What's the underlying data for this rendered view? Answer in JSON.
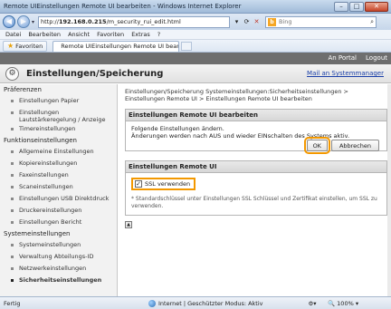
{
  "window": {
    "title": "Remote UIEinstellungen Remote UI bearbeiten",
    "title_suffix": "- Windows Internet Explorer",
    "min": "–",
    "max": "□",
    "close": "✕"
  },
  "navbar": {
    "url_prefix": "http://",
    "url_host": "192.168.0.215",
    "url_path": "/m_security_rui_edit.html",
    "search_placeholder": "Bing",
    "search_logo": "b"
  },
  "menu": [
    "Datei",
    "Bearbeiten",
    "Ansicht",
    "Favoriten",
    "Extras",
    "?"
  ],
  "favbar": {
    "favorites_label": "Favoriten",
    "tab_label": "Remote UIEinstellungen Remote UI bearbeiten"
  },
  "page": {
    "portal": "An Portal",
    "logout": "Logout",
    "header_title": "Einstellungen/Speicherung",
    "main_link": "Mail an Systemmanager",
    "sidebar": {
      "sections": [
        {
          "title": "Präferenzen",
          "items": [
            "Einstellungen Papier",
            "Einstellungen Lautstärkeregelung / Anzeige",
            "Timereinstellungen"
          ]
        },
        {
          "title": "Funktionseinstellungen",
          "items": [
            "Allgemeine Einstellungen",
            "Kopiereinstellungen",
            "Faxeinstellungen",
            "Scaneinstellungen",
            "Einstellungen USB Direktdruck",
            "Druckereinstellungen",
            "Einstellungen Bericht"
          ]
        },
        {
          "title": "Systemeinstellungen",
          "items": [
            "Systemeinstellungen",
            "Verwaltung Abteilungs-ID",
            "Netzwerkeinstellungen",
            "Sicherheitseinstellungen"
          ]
        }
      ]
    },
    "breadcrumb": "Einstellungen/Speicherung Systemeinstellungen:Sicherheitseinstellungen > Einstellungen Remote UI > Einstellungen Remote UI bearbeiten",
    "edit_panel": {
      "title": "Einstellungen Remote UI bearbeiten",
      "line1": "Folgende Einstellungen ändern.",
      "line2": "Änderungen werden nach AUS und wieder EINschalten des Systems aktiv.",
      "ok": "OK",
      "cancel": "Abbrechen"
    },
    "settings_panel": {
      "title": "Einstellungen Remote UI",
      "ssl_label": "SSL verwenden",
      "ssl_checked": true,
      "check_mark": "✓",
      "note": "* Standardschlüssel unter Einstellungen SSL Schlüssel und Zertifikat einstellen, um SSL zu verwenden."
    }
  },
  "status": {
    "left": "Fertig",
    "zone": "Internet | Geschützter Modus: Aktiv",
    "zoom": "100%"
  }
}
